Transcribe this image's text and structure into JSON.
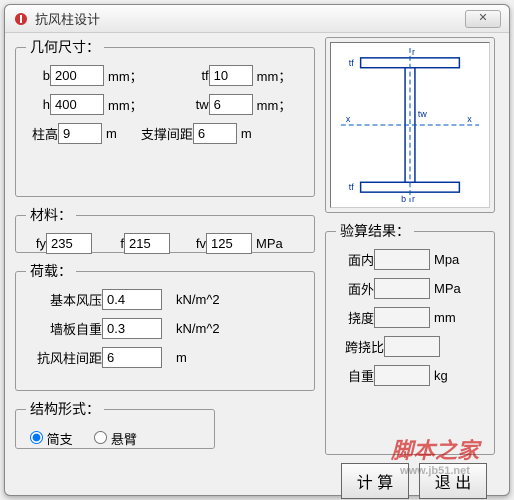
{
  "window": {
    "title": "抗风柱设计",
    "close": "✕"
  },
  "geom": {
    "legend": "几何尺寸：",
    "b_label": "b",
    "b": "200",
    "b_unit": "mm；",
    "tf_label": "tf",
    "tf": "10",
    "tf_unit": "mm；",
    "h_label": "h",
    "h": "400",
    "h_unit": "mm；",
    "tw_label": "tw",
    "tw": "6",
    "tw_unit": "mm；",
    "colh_label": "柱高",
    "colh": "9",
    "colh_unit": "m",
    "spacing_label": "支撑间距",
    "spacing": "6",
    "spacing_unit": "m"
  },
  "material": {
    "legend": "材料：",
    "fy_label": "fy",
    "fy": "235",
    "f_label": "f",
    "f": "215",
    "fv_label": "fv",
    "fv": "125",
    "unit": "MPa"
  },
  "load": {
    "legend": "荷载：",
    "wind_label": "基本风压",
    "wind": "0.4",
    "wind_unit": "kN/m^2",
    "wall_label": "墙板自重",
    "wall": "0.3",
    "wall_unit": "kN/m^2",
    "dist_label": "抗风柱间距",
    "dist": "6",
    "dist_unit": "m"
  },
  "struct": {
    "legend": "结构形式：",
    "opt1": "简支",
    "opt2": "悬臂"
  },
  "diagram": {
    "labels": {
      "top": "r",
      "bottom": "r",
      "left_x": "x",
      "right_x": "x",
      "tw": "tw",
      "tf_top": "tf",
      "tf_bottom": "tf",
      "b": "b"
    }
  },
  "result": {
    "legend": "验算结果：",
    "in_label": "面内",
    "in_unit": "Mpa",
    "out_label": "面外",
    "out_unit": "MPa",
    "defl_label": "挠度",
    "defl_unit": "mm",
    "ratio_label": "跨挠比",
    "weight_label": "自重",
    "weight_unit": "kg"
  },
  "buttons": {
    "calc": "计 算",
    "exit": "退 出"
  },
  "watermark": {
    "text": "脚本之家",
    "url": "www.jb51.net"
  }
}
